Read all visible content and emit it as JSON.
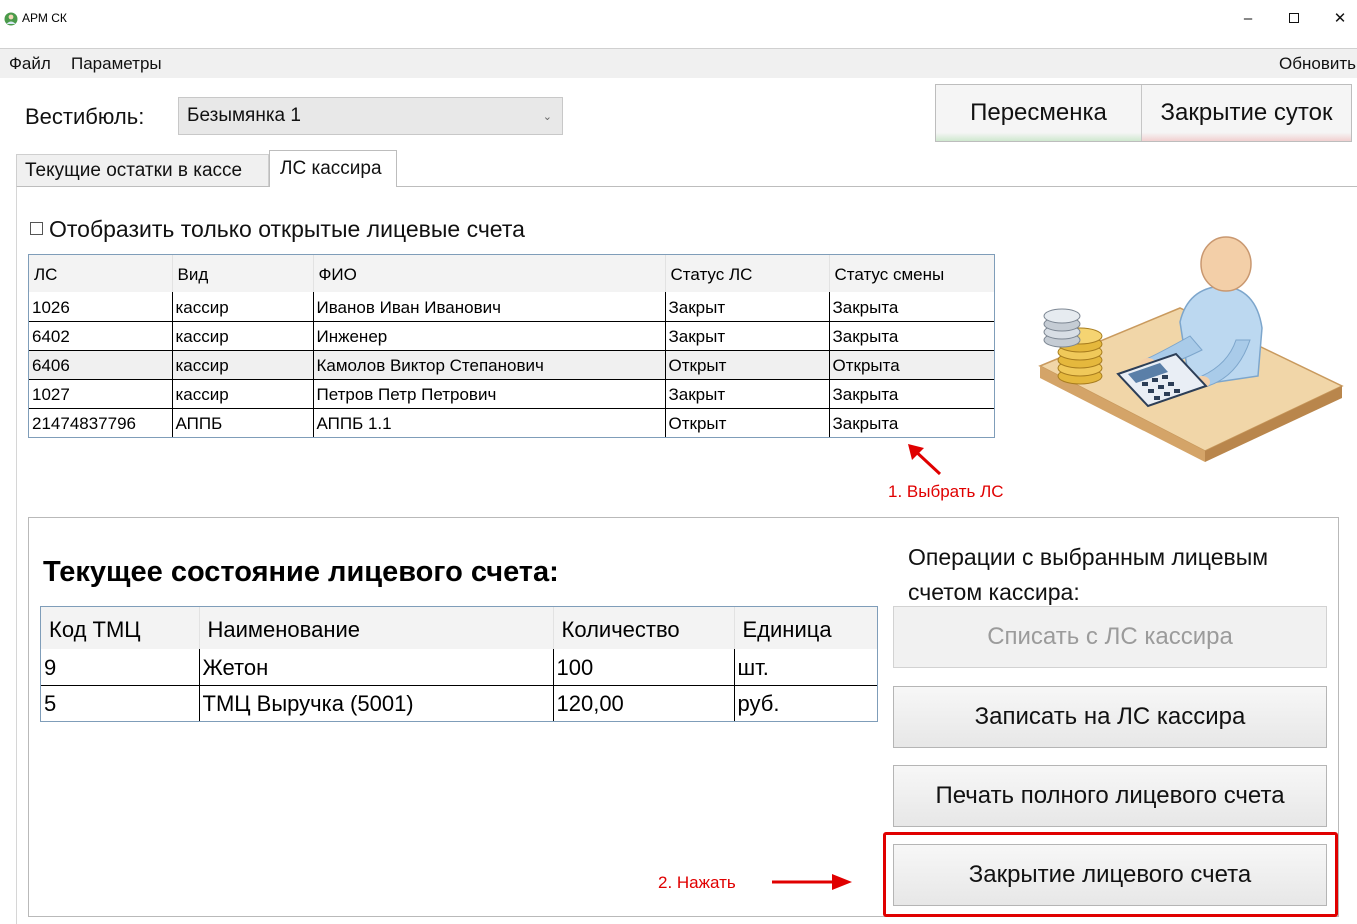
{
  "window": {
    "title": "АРМ СК",
    "minimize_label": "–",
    "close_label": "✕"
  },
  "menu": {
    "file": "Файл",
    "params": "Параметры",
    "refresh": "Обновить"
  },
  "vestibule": {
    "label": "Вестибюль:",
    "selected": "Безымянка 1"
  },
  "top_buttons": {
    "shift_change": "Пересменка",
    "day_close": "Закрытие суток"
  },
  "tabs": [
    {
      "label": "Текущие остатки в кассе",
      "active": false
    },
    {
      "label": "ЛС кассира",
      "active": true
    }
  ],
  "filter_checkbox": {
    "label": "Отобразить только открытые лицевые счета",
    "checked": false
  },
  "accounts_table": {
    "columns": [
      "ЛС",
      "Вид",
      "ФИО",
      "Статус ЛС",
      "Статус смены"
    ],
    "rows": [
      [
        "1026",
        "кассир",
        "Иванов Иван Иванович",
        "Закрыт",
        "Закрыта"
      ],
      [
        "6402",
        "кассир",
        "Инженер",
        "Закрыт",
        "Закрыта"
      ],
      [
        "6406",
        "кассир",
        "Камолов Виктор Степанович",
        "Открыт",
        "Открыта"
      ],
      [
        "1027",
        "кассир",
        "Петров Петр Петрович",
        "Закрыт",
        "Закрыта"
      ],
      [
        "21474837796",
        "АППБ",
        "АППБ 1.1",
        "Открыт",
        "Закрыта"
      ]
    ],
    "selected_row": 2
  },
  "annotations": {
    "step1": "1. Выбрать ЛС",
    "step2": "2. Нажать",
    "color": "#e00000"
  },
  "account_state": {
    "title": "Текущее состояние лицевого счета:",
    "columns": [
      "Код ТМЦ",
      "Наименование",
      "Количество",
      "Единица"
    ],
    "rows": [
      [
        "9",
        "Жетон",
        "100",
        "шт."
      ],
      [
        "5",
        "ТМЦ Выручка (5001)",
        "120,00",
        "руб."
      ]
    ]
  },
  "operations": {
    "title": "Операции с выбранным лицевым счетом кассира:",
    "write_off": "Списать с ЛС кассира",
    "credit": "Записать на ЛС кассира",
    "print_full": "Печать полного лицевого счета",
    "close_account": "Закрытие лицевого счета"
  }
}
